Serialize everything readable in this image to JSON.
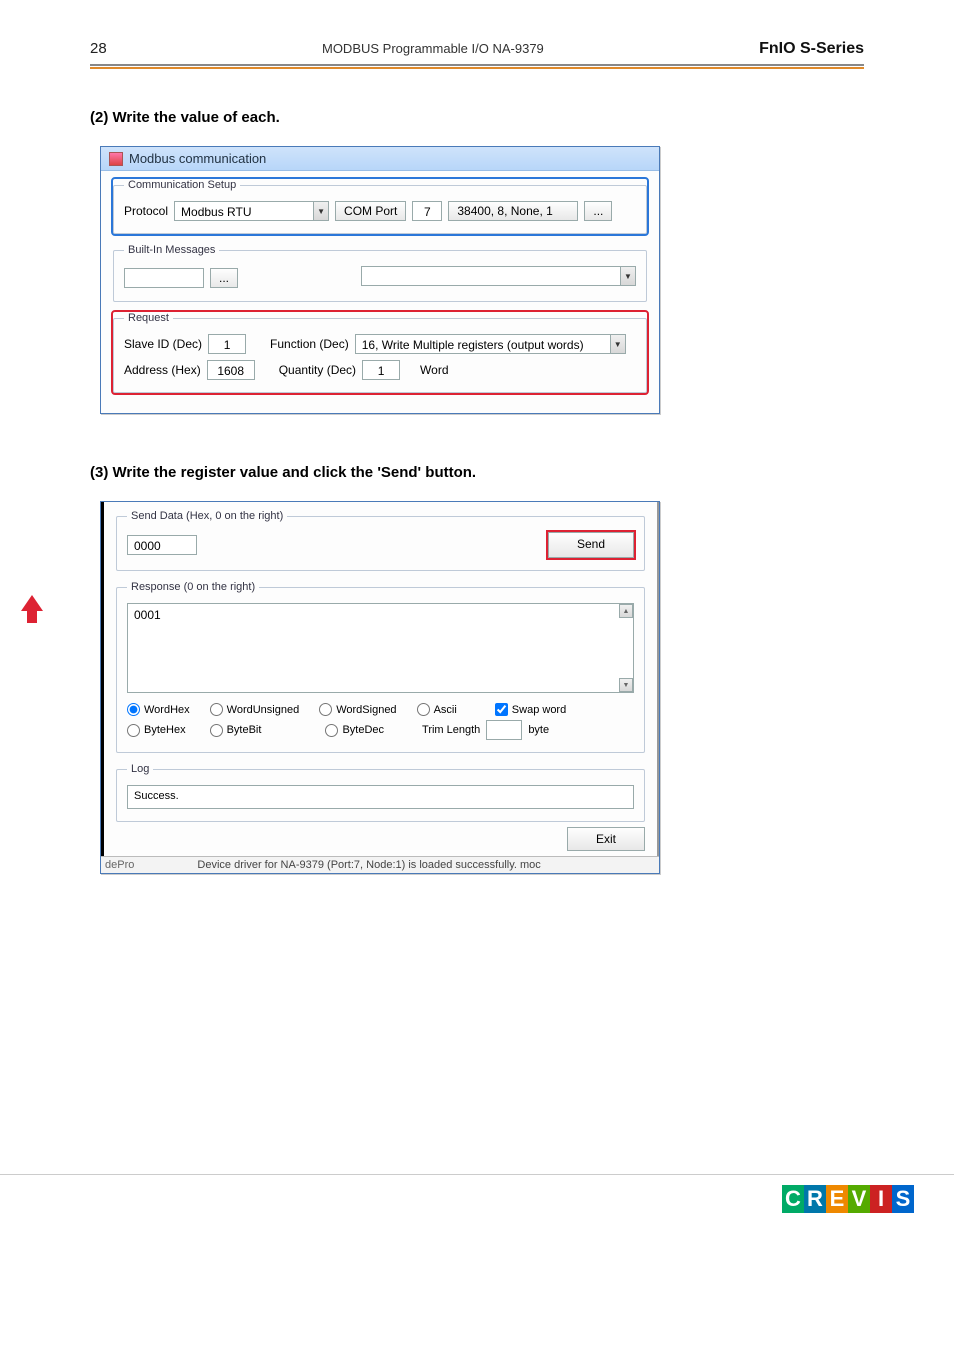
{
  "header": {
    "page_num": "28",
    "center": "MODBUS Programmable I/O NA-9379",
    "right": "FnIO  S-Series"
  },
  "step2_title": "(2) Write the value of each.",
  "step3_title": "(3) Write the register value and click the 'Send' button.",
  "win1": {
    "title": "Modbus communication",
    "comm_setup": {
      "legend": "Communication Setup",
      "protocol_label": "Protocol",
      "protocol_value": "Modbus RTU",
      "comport_btn": "COM Port",
      "comport_value": "7",
      "baud_btn": "38400, 8, None, 1",
      "dots_btn": "..."
    },
    "builtin": {
      "legend": "Built-In Messages",
      "dots_btn": "..."
    },
    "request": {
      "legend": "Request",
      "slave_label": "Slave ID (Dec)",
      "slave_value": "1",
      "func_label": "Function (Dec)",
      "func_value": "16, Write Multiple registers (output words)",
      "addr_label": "Address (Hex)",
      "addr_value": "1608",
      "qty_label": "Quantity (Dec)",
      "qty_value": "1",
      "unit": "Word"
    }
  },
  "dlg2": {
    "send_legend": "Send Data (Hex, 0 on the right)",
    "send_value": "0000",
    "send_btn": "Send",
    "resp_legend": "Response (0 on the right)",
    "resp_value": "0001",
    "radios": {
      "wordhex": "WordHex",
      "wordunsigned": "WordUnsigned",
      "wordsigned": "WordSigned",
      "ascii": "Ascii",
      "bytehex": "ByteHex",
      "bytebit": "ByteBit",
      "bytedec": "ByteDec"
    },
    "swap_label": "Swap word",
    "trim_label": "Trim Length",
    "trim_suffix": "byte",
    "log_legend": "Log",
    "log_value": "Success.",
    "exit_btn": "Exit",
    "status_left": "dePro",
    "status_msg": "Device driver for NA-9379 (Port:7, Node:1) is loaded successfully. moc"
  },
  "logo": "CREVIS"
}
